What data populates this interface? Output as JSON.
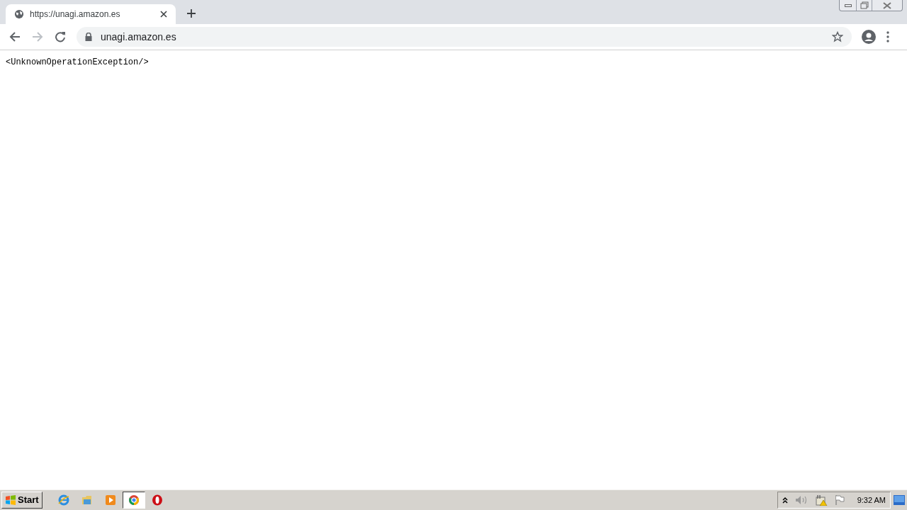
{
  "tab": {
    "title": "https://unagi.amazon.es"
  },
  "address_bar": {
    "url": "unagi.amazon.es"
  },
  "page": {
    "content": "<UnknownOperationException/>"
  },
  "taskbar": {
    "start": "Start",
    "apps": [
      {
        "kind": "ie",
        "selected": false
      },
      {
        "kind": "folder",
        "selected": false
      },
      {
        "kind": "media",
        "selected": false
      },
      {
        "kind": "chrome",
        "selected": true
      },
      {
        "kind": "opera",
        "selected": false
      }
    ],
    "clock": "9:32 AM"
  }
}
